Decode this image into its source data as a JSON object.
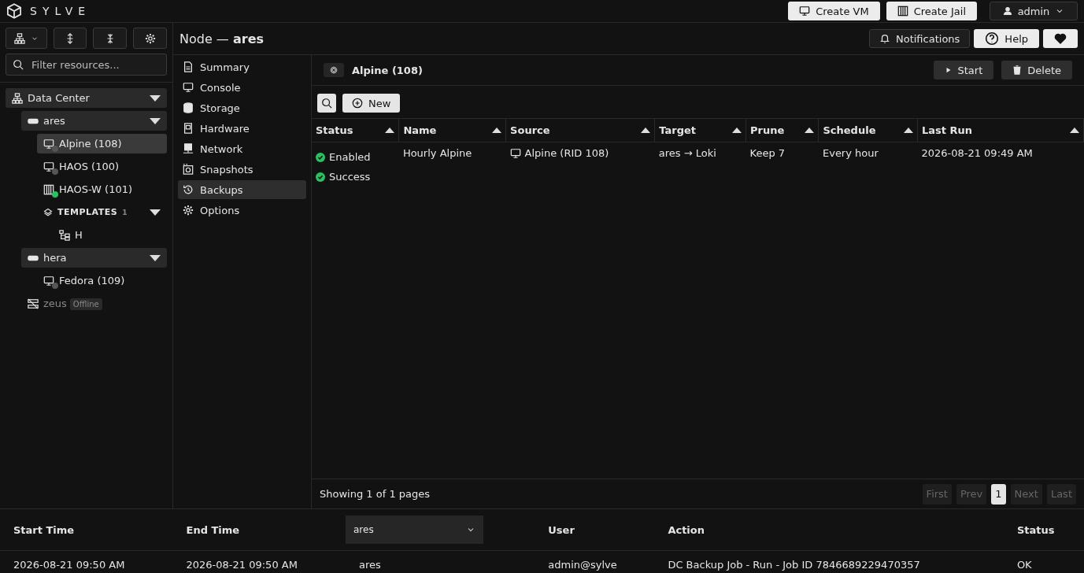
{
  "header": {
    "brand": "SYLVE",
    "buttons": [
      {
        "kind": "vm",
        "label": "Create VM"
      },
      {
        "kind": "jail",
        "label": "Create Jail"
      }
    ],
    "user": "admin"
  },
  "sidebar": {
    "search": {
      "placeholder": "Filter resources..."
    },
    "tree": [
      {
        "kind": "datacenter",
        "label": "Data Center",
        "expanded": true,
        "selected": false,
        "children": [
          {
            "kind": "node",
            "label": "ares",
            "expanded": true,
            "selected": false,
            "children": [
              {
                "kind": "vm",
                "label": "Alpine (108)",
                "selected": true,
                "color": "#555555"
              },
              {
                "kind": "vm",
                "label": "HAOS (100)",
                "selected": false,
                "color": "#555555"
              },
              {
                "kind": "jail",
                "label": "HAOS-W (101)",
                "selected": false,
                "color": "#22c55e"
              },
              {
                "kind": "templates",
                "label": "TEMPLATES",
                "count": "1",
                "expanded": true,
                "selected": false,
                "children": [
                  {
                    "kind": "template",
                    "label": "H",
                    "selected": false
                  }
                ]
              }
            ]
          },
          {
            "kind": "node",
            "label": "hera",
            "expanded": true,
            "selected": false,
            "children": [
              {
                "kind": "vm",
                "label": "Fedora (109)",
                "selected": false,
                "color": "#555555"
              }
            ]
          },
          {
            "kind": "offline",
            "label": "zeus",
            "badge": "Offline",
            "selected": false
          }
        ]
      }
    ]
  },
  "title": {
    "prefix": "Node —",
    "name": "ares"
  },
  "top_actions": [
    {
      "kind": "bell",
      "label": "Notifications"
    },
    {
      "kind": "help",
      "label": "Help"
    },
    {
      "kind": "heart"
    }
  ],
  "nav": [
    {
      "kind": "summary",
      "label": "Summary",
      "selected": false
    },
    {
      "kind": "console",
      "label": "Console",
      "selected": false
    },
    {
      "kind": "storage",
      "label": "Storage",
      "selected": false
    },
    {
      "kind": "hardware",
      "label": "Hardware",
      "selected": false
    },
    {
      "kind": "network",
      "label": "Network",
      "selected": false
    },
    {
      "kind": "snapshots",
      "label": "Snapshots",
      "selected": false
    },
    {
      "kind": "backups",
      "label": "Backups",
      "selected": true
    },
    {
      "kind": "options",
      "label": "Options",
      "selected": false
    }
  ],
  "panel": {
    "title": "Alpine (108)",
    "actions": [
      {
        "kind": "play",
        "label": "Start"
      },
      {
        "kind": "trash",
        "label": "Delete"
      }
    ],
    "new_button": "New",
    "table": {
      "columns": [
        "Status",
        "Name",
        "Source",
        "Target",
        "Prune",
        "Schedule",
        "Last Run"
      ],
      "rows": [
        {
          "status": [
            "Enabled",
            "Success"
          ],
          "name": "Hourly Alpine",
          "source": "Alpine (RID 108)",
          "target": "ares → Loki",
          "prune": "Keep 7",
          "schedule": "Every hour",
          "last_run": "2026-08-21 09:49 AM"
        }
      ]
    },
    "footer": "Showing 1 of 1 pages",
    "pagination": [
      {
        "label": "First",
        "disabled": true,
        "selected": false
      },
      {
        "label": "Prev",
        "disabled": true,
        "selected": false
      },
      {
        "label": "1",
        "disabled": false,
        "selected": true
      },
      {
        "label": "Next",
        "disabled": true,
        "selected": false
      },
      {
        "label": "Last",
        "disabled": true,
        "selected": false
      }
    ]
  },
  "tasks": {
    "columns": [
      {
        "kind": "text",
        "label": "Start Time"
      },
      {
        "kind": "text",
        "label": "End Time"
      },
      {
        "kind": "select",
        "label": "ares"
      },
      {
        "kind": "text",
        "label": "User"
      },
      {
        "kind": "text",
        "label": "Action"
      },
      {
        "kind": "text",
        "label": "Status"
      }
    ],
    "rows": [
      [
        "2026-08-21 09:50 AM",
        "2026-08-21 09:50 AM",
        "ares",
        "admin@sylve",
        "DC Backup Job - Run - Job ID 7846689229470357",
        "OK"
      ]
    ]
  }
}
